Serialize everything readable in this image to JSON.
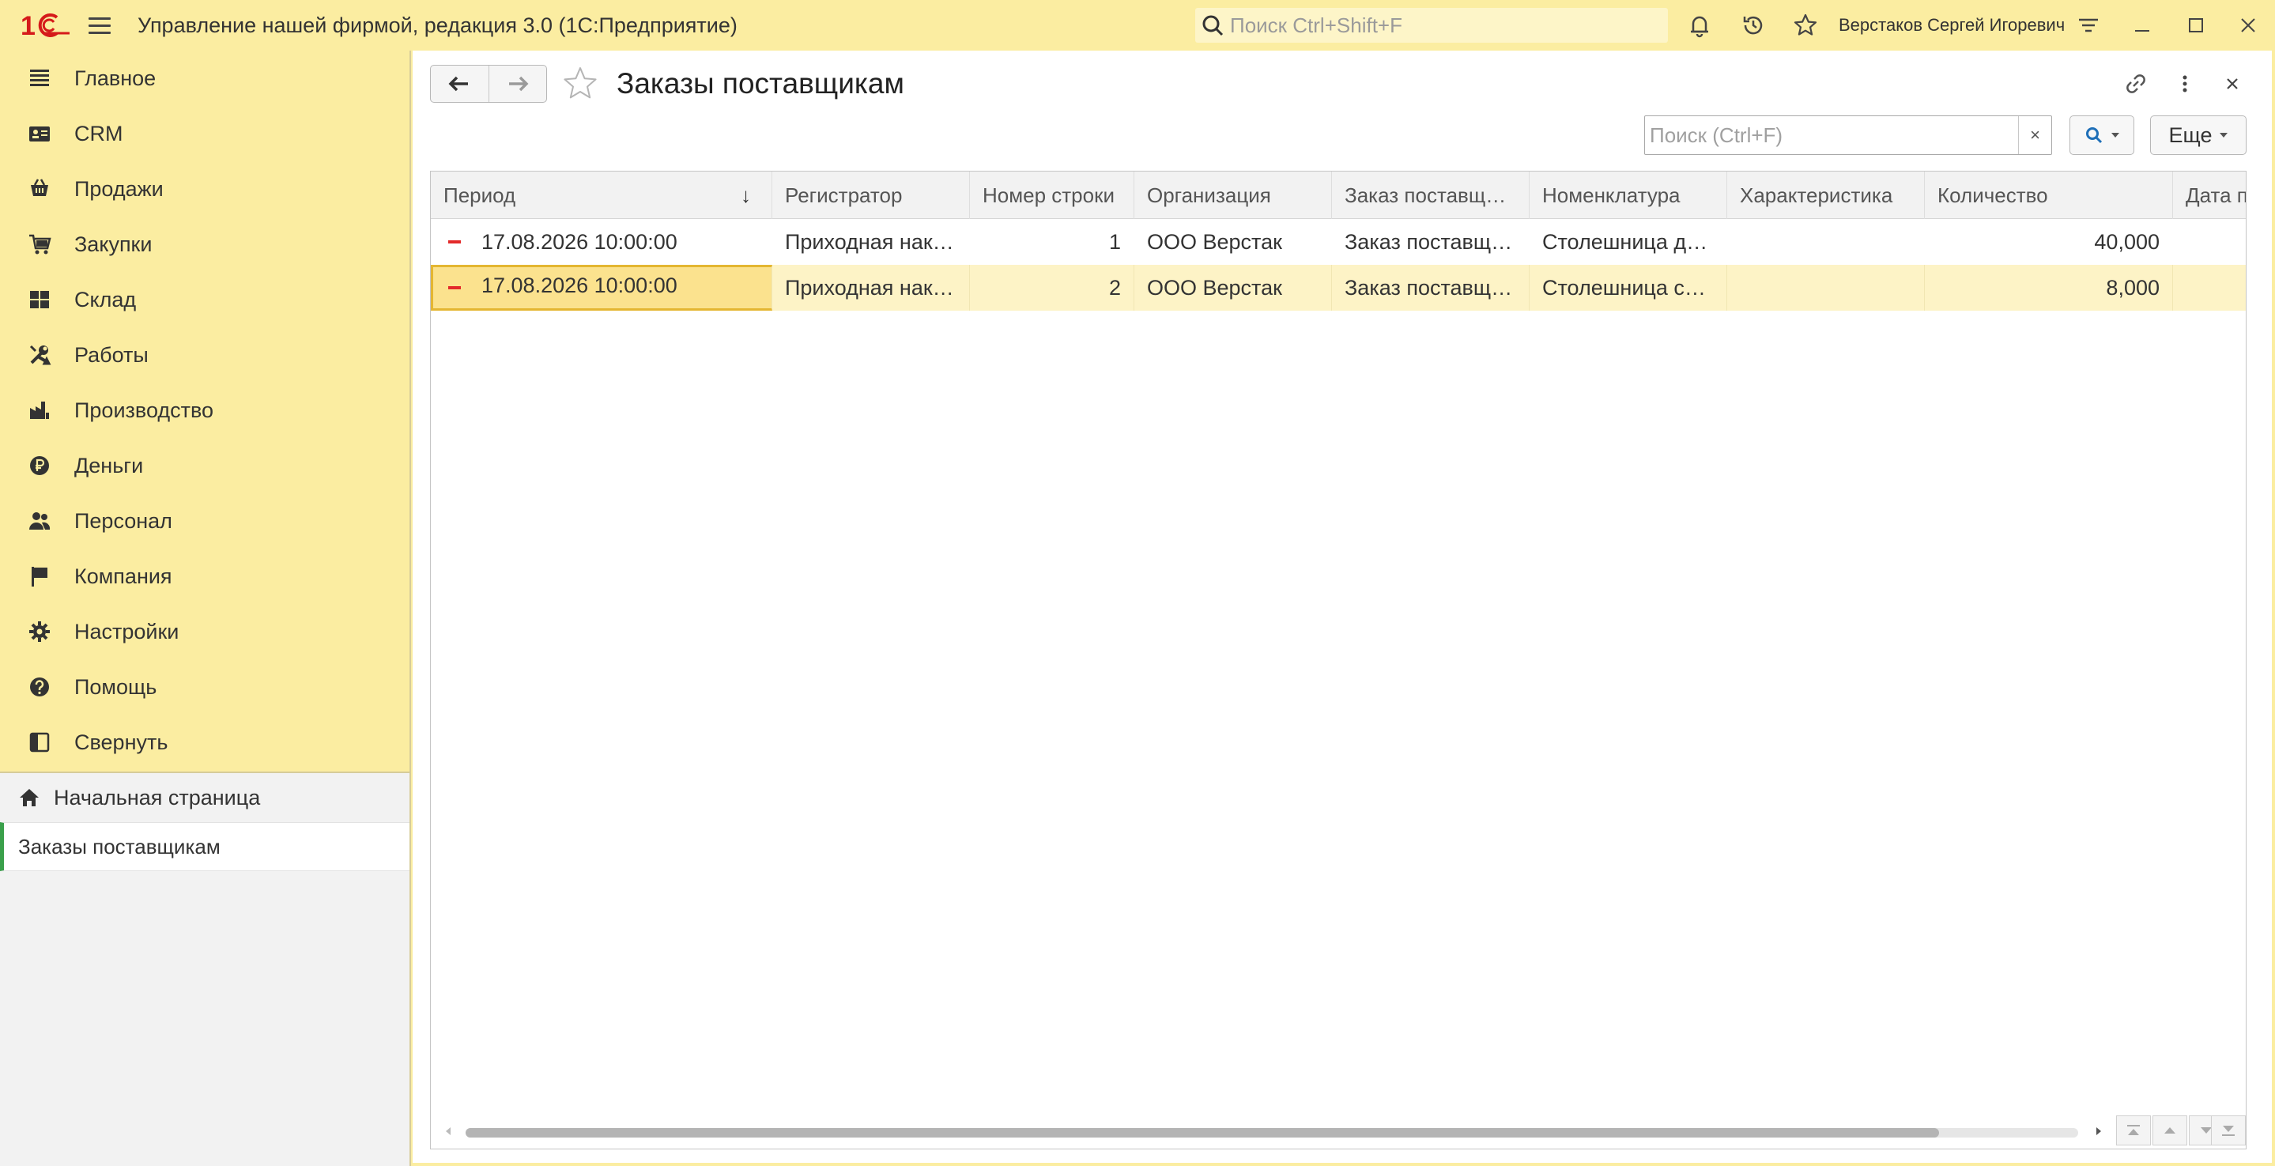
{
  "titlebar": {
    "logo": "1С",
    "app_title": "Управление нашей фирмой, редакция 3.0  (1С:Предприятие)",
    "search_placeholder": "Поиск Ctrl+Shift+F",
    "user_name": "Верстаков Сергей Игоревич",
    "icons": [
      "bell-icon",
      "history-icon",
      "star-icon",
      "settings-lines-icon",
      "minimize-icon",
      "maximize-icon",
      "close-icon"
    ]
  },
  "sidebar": {
    "items": [
      {
        "label": "Главное",
        "icon": "list-icon"
      },
      {
        "label": "CRM",
        "icon": "crm-icon"
      },
      {
        "label": "Продажи",
        "icon": "cart-icon"
      },
      {
        "label": "Закупки",
        "icon": "purchases-icon"
      },
      {
        "label": "Склад",
        "icon": "warehouse-icon"
      },
      {
        "label": "Работы",
        "icon": "tools-icon"
      },
      {
        "label": "Производство",
        "icon": "factory-icon"
      },
      {
        "label": "Деньги",
        "icon": "ruble-icon"
      },
      {
        "label": "Персонал",
        "icon": "people-icon"
      },
      {
        "label": "Компания",
        "icon": "flag-icon"
      },
      {
        "label": "Настройки",
        "icon": "gear-icon"
      },
      {
        "label": "Помощь",
        "icon": "help-icon"
      },
      {
        "label": "Свернуть",
        "icon": "collapse-icon"
      }
    ],
    "open_pages": {
      "home": "Начальная страница",
      "current": "Заказы поставщикам"
    }
  },
  "main": {
    "title": "Заказы поставщикам",
    "search_placeholder": "Поиск (Ctrl+F)",
    "clear_label": "×",
    "more_label": "Еще",
    "columns": [
      "Период",
      "Регистратор",
      "Номер строки",
      "Организация",
      "Заказ поставщ…",
      "Номенклатура",
      "Характеристика",
      "Количество",
      "Дата п"
    ],
    "sort_indicator": "↓",
    "rows": [
      {
        "period": "17.08.2026 10:00:00",
        "registrator": "Приходная нак…",
        "line": "1",
        "org": "ООО Верстак",
        "order": "Заказ поставщ…",
        "item": "Столешница д…",
        "characteristic": "",
        "qty": "40,000",
        "date": ""
      },
      {
        "period": "17.08.2026 10:00:00",
        "registrator": "Приходная нак…",
        "line": "2",
        "org": "ООО Верстак",
        "order": "Заказ поставщ…",
        "item": "Столешница с…",
        "characteristic": "",
        "qty": "8,000",
        "date": ""
      }
    ]
  },
  "colors": {
    "sidebar_bg": "#fbeda1",
    "selected_row": "#fdf3c6",
    "focus_cell": "#fbe28e",
    "expense_mark": "#e32a2a",
    "logo_red": "#d51a1a",
    "active_page_marker": "#3aa04b"
  }
}
